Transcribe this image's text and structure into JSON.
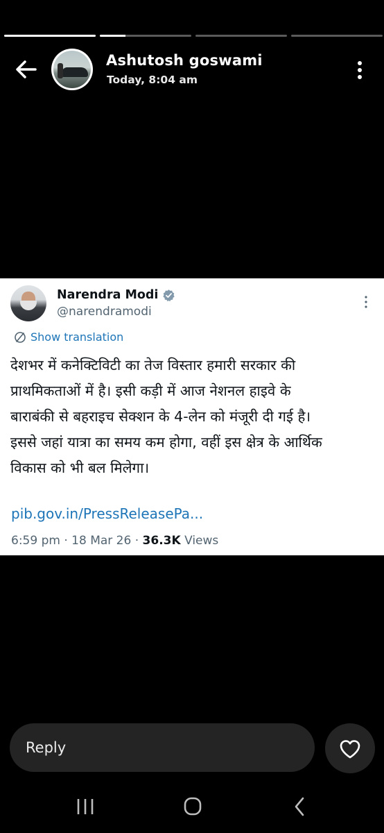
{
  "story": {
    "progress": [
      1.0,
      0.28,
      0.0,
      0.0
    ]
  },
  "header": {
    "author_name": "Ashutosh goswami",
    "timestamp": "Today, 8:04 am",
    "icons": {
      "back": "back-arrow-icon",
      "more": "more-vertical-icon"
    }
  },
  "tweet": {
    "author_name": "Narendra Modi",
    "handle": "@narendramodi",
    "verified": true,
    "translate_label": "Show translation",
    "text": "देशभर में कनेक्टिविटी का तेज विस्तार हमारी सरकार की\nप्राथमिकताओं में है। इसी कड़ी में आज नेशनल हाइवे के\nबाराबंकी से बहराइच सेक्शन के 4-लेन को मंजूरी दी गई है।\nइससे जहां यात्रा का समय कम होगा, वहीं इस क्षेत्र के आर्थिक\nविकास को भी बल मिलेगा।",
    "link": "pib.gov.in/PressReleasePa...",
    "time": "6:59 pm",
    "date": "18 Mar 26",
    "views_count": "36.3K",
    "views_label": "Views",
    "separator": "·",
    "colors": {
      "link": "#1d75b8",
      "verified": "#829aab"
    }
  },
  "reply": {
    "placeholder": "Reply",
    "like_icon": "heart-outline-icon"
  },
  "nav": {
    "icons": [
      "recents-icon",
      "home-icon",
      "back-icon"
    ]
  }
}
